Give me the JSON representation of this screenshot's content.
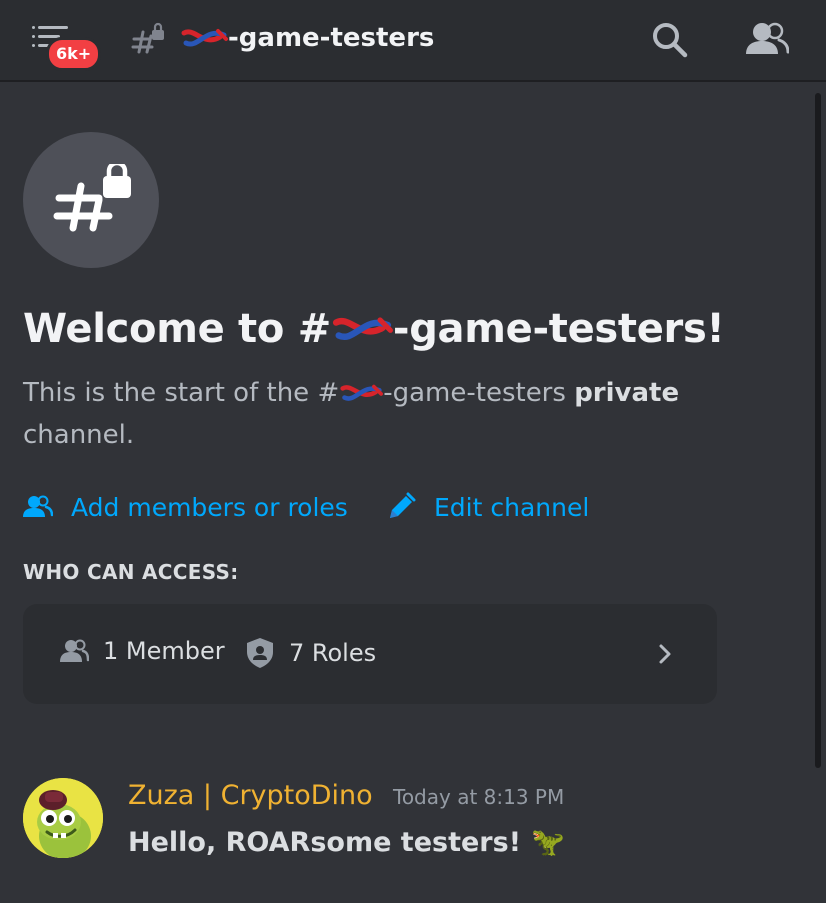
{
  "header": {
    "notification_badge": "6k+",
    "channel_name": "-game-testers",
    "channel_icon": "knot-emoji",
    "icons": [
      "menu-icon",
      "hash-lock-icon",
      "search-icon",
      "members-icon"
    ]
  },
  "welcome": {
    "title_prefix": "Welcome to #",
    "title_suffix": "-game-testers!",
    "desc_prefix": "This is the start of the #",
    "desc_channel": "-game-testers",
    "desc_strong": "private",
    "desc_suffix": "channel."
  },
  "actions": {
    "add_members_label": "Add members or roles",
    "edit_channel_label": "Edit channel"
  },
  "access": {
    "heading": "WHO CAN ACCESS:",
    "members_label": "1 Member",
    "roles_label": "7 Roles"
  },
  "message": {
    "author": "Zuza | CryptoDino",
    "timestamp": "Today at 8:13 PM",
    "text": "Hello, ROARsome testers!",
    "emoji": "🦖"
  },
  "colors": {
    "background": "#313338",
    "topbar": "#2b2d31",
    "link": "#00a8fc",
    "author": "#f0b232",
    "badge": "#f23f43"
  }
}
